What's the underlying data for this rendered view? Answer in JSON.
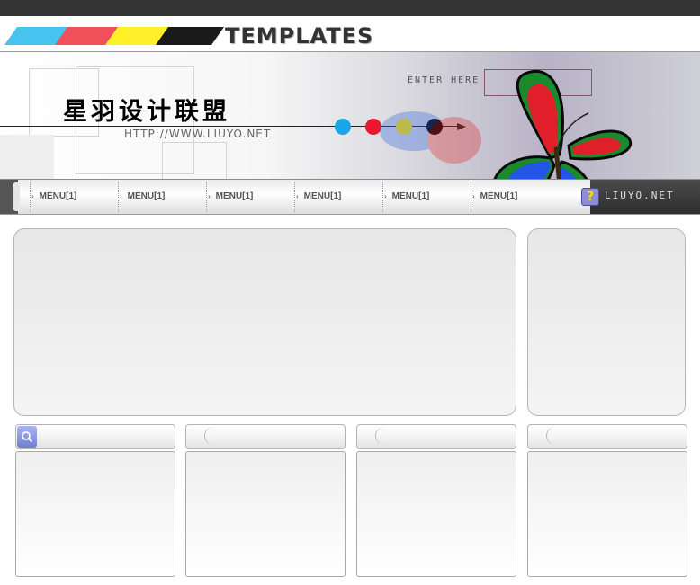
{
  "header": {
    "logo_text": "TEMPLATES",
    "stripe_colors": [
      "#47c3f0",
      "#f0505a",
      "#fff02a",
      "#1a1a1a"
    ]
  },
  "banner": {
    "title_cn": "星羽设计联盟",
    "url": "HTTP://WWW.LIUYO.NET",
    "enter_here": "ENTER HERE",
    "dot_colors": [
      "#1aa7e8",
      "#e8192f",
      "#ffe600",
      "#000000"
    ]
  },
  "nav": {
    "items": [
      {
        "label": "MENU[1]"
      },
      {
        "label": "MENU[1]"
      },
      {
        "label": "MENU[1]"
      },
      {
        "label": "MENU[1]"
      },
      {
        "label": "MENU[1]"
      },
      {
        "label": "MENU[1]"
      }
    ],
    "help_glyph": "?",
    "brand": "LIUYO.NET"
  },
  "icons": {
    "help": "help-icon",
    "search": "search-icon",
    "butterfly": "butterfly-icon"
  }
}
